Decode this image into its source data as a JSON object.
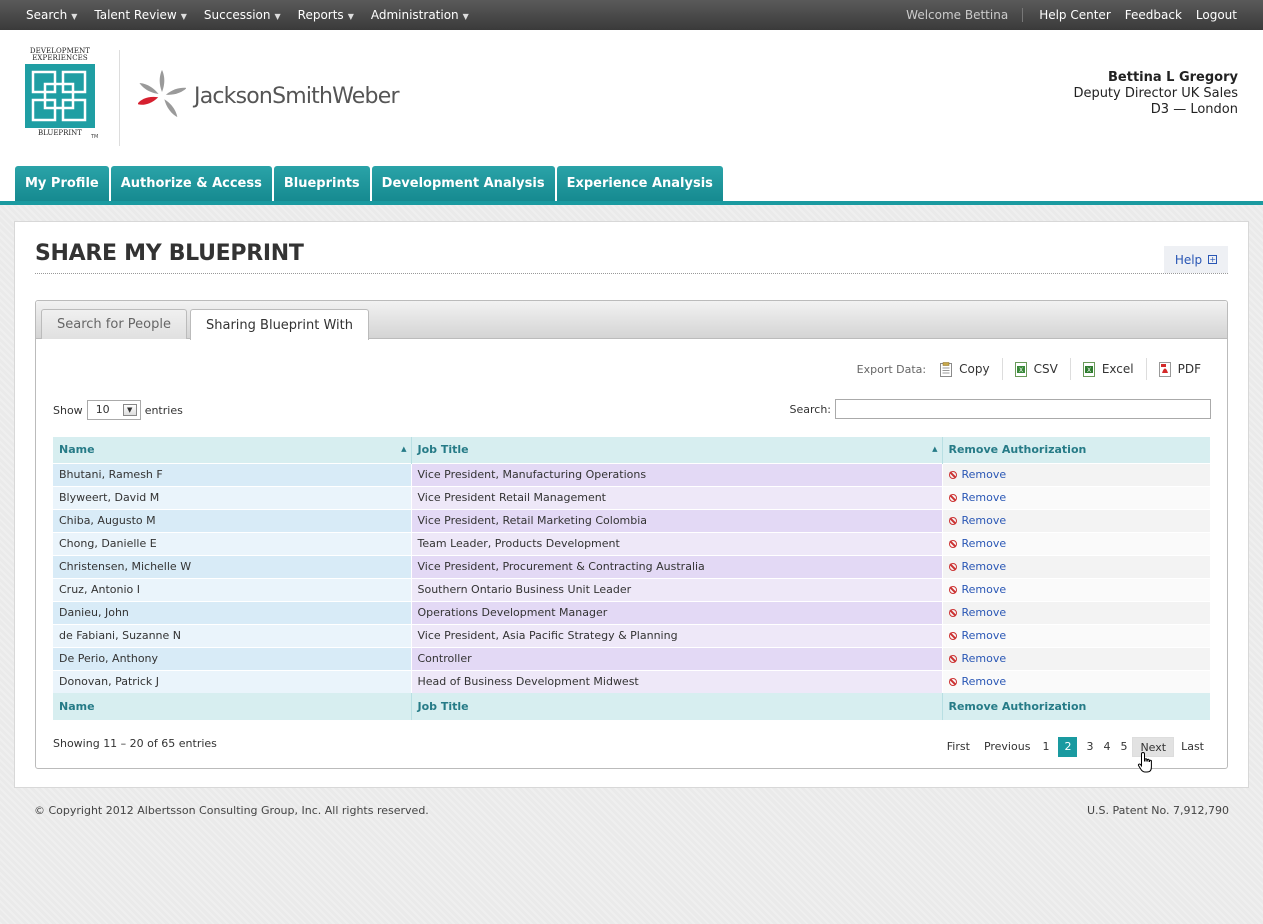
{
  "topnav": {
    "menus": [
      "Search",
      "Talent Review",
      "Succession",
      "Reports",
      "Administration"
    ],
    "welcome": "Welcome Bettina",
    "links": [
      "Help Center",
      "Feedback",
      "Logout"
    ]
  },
  "brand": {
    "logo_top": "DEVELOPMENT EXPERIENCES",
    "logo_bottom": "BLUEPRINT",
    "logo_tm": "TM",
    "company": "JacksonSmithWeber"
  },
  "user": {
    "name": "Bettina L Gregory",
    "title": "Deputy Director UK Sales",
    "location": "D3 — London"
  },
  "main_tabs": [
    "My Profile",
    "Authorize & Access",
    "Blueprints",
    "Development Analysis",
    "Experience Analysis"
  ],
  "page": {
    "title": "SHARE MY BLUEPRINT",
    "help": "Help"
  },
  "inner_tabs": [
    "Search for People",
    "Sharing Blueprint With"
  ],
  "export": {
    "label": "Export Data:",
    "buttons": [
      "Copy",
      "CSV",
      "Excel",
      "PDF"
    ]
  },
  "table_controls": {
    "show_label": "Show",
    "page_size": "10",
    "entries_label": "entries",
    "search_label": "Search:",
    "search_value": ""
  },
  "table": {
    "columns": [
      "Name",
      "Job Title",
      "Remove Authorization"
    ],
    "action_label": "Remove",
    "rows": [
      {
        "name": "Bhutani, Ramesh F",
        "title": "Vice President, Manufacturing Operations"
      },
      {
        "name": "Blyweert, David M",
        "title": "Vice President Retail Management"
      },
      {
        "name": "Chiba, Augusto M",
        "title": "Vice President, Retail Marketing Colombia"
      },
      {
        "name": "Chong, Danielle E",
        "title": "Team Leader, Products Development"
      },
      {
        "name": "Christensen, Michelle W",
        "title": "Vice President, Procurement & Contracting Australia"
      },
      {
        "name": "Cruz, Antonio I",
        "title": "Southern Ontario Business Unit Leader"
      },
      {
        "name": "Danieu, John",
        "title": "Operations Development Manager"
      },
      {
        "name": "de Fabiani, Suzanne N",
        "title": "Vice President, Asia Pacific Strategy & Planning"
      },
      {
        "name": "De Perio, Anthony",
        "title": "Controller"
      },
      {
        "name": "Donovan, Patrick J",
        "title": "Head of Business Development Midwest"
      }
    ]
  },
  "pagination": {
    "info": "Showing 11 – 20 of 65 entries",
    "first": "First",
    "previous": "Previous",
    "pages": [
      "1",
      "2",
      "3",
      "4",
      "5"
    ],
    "current": "2",
    "next": "Next",
    "last": "Last"
  },
  "footer": {
    "copyright": "© Copyright 2012 Albertsson Consulting Group, Inc. All rights reserved.",
    "patent": "U.S. Patent No. 7,912,790"
  }
}
